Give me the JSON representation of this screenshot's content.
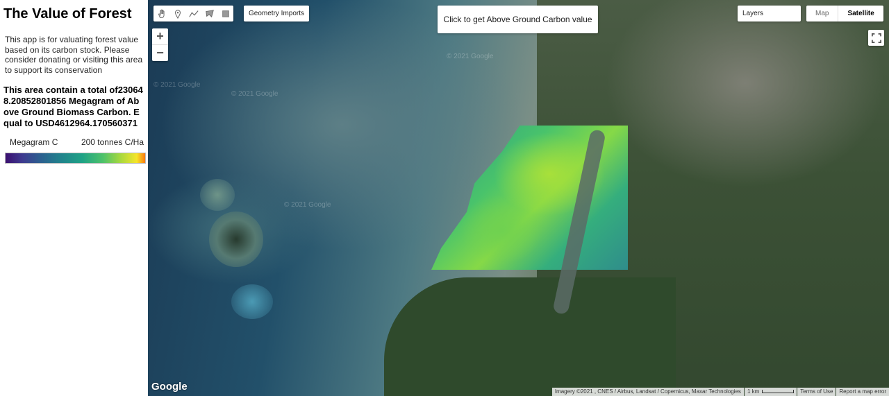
{
  "sidebar": {
    "title": "The Value of Forest",
    "description": "This app is for valuating forest value based on its carbon stock. Please consider donating or visiting this area to support its conservation",
    "total_text": "This area contain a total of230648.20852801856 Megagram of Above Ground Biomass Carbon. Equal to USD4612964.170560371",
    "legend": {
      "min_label": "Megagram C",
      "max_label": "200 tonnes C/Ha"
    }
  },
  "map": {
    "drawing_tools": [
      {
        "name": "hand-icon"
      },
      {
        "name": "point-marker-icon"
      },
      {
        "name": "line-icon"
      },
      {
        "name": "polygon-icon"
      },
      {
        "name": "rectangle-icon"
      }
    ],
    "geometry_imports_label": "Geometry Imports",
    "zoom_in_label": "+",
    "zoom_out_label": "−",
    "carbon_button_label": "Click to get Above Ground Carbon value",
    "layers_label": "Layers",
    "map_type_options": [
      "Map",
      "Satellite"
    ],
    "map_type_selected": "Satellite",
    "watermark": "© 2021 Google",
    "logo": "Google",
    "attribution": {
      "imagery": "Imagery ©2021 , CNES / Airbus, Landsat / Copernicus, Maxar Technologies",
      "scale": "1 km",
      "terms": "Terms of Use",
      "report": "Report a map error"
    }
  }
}
